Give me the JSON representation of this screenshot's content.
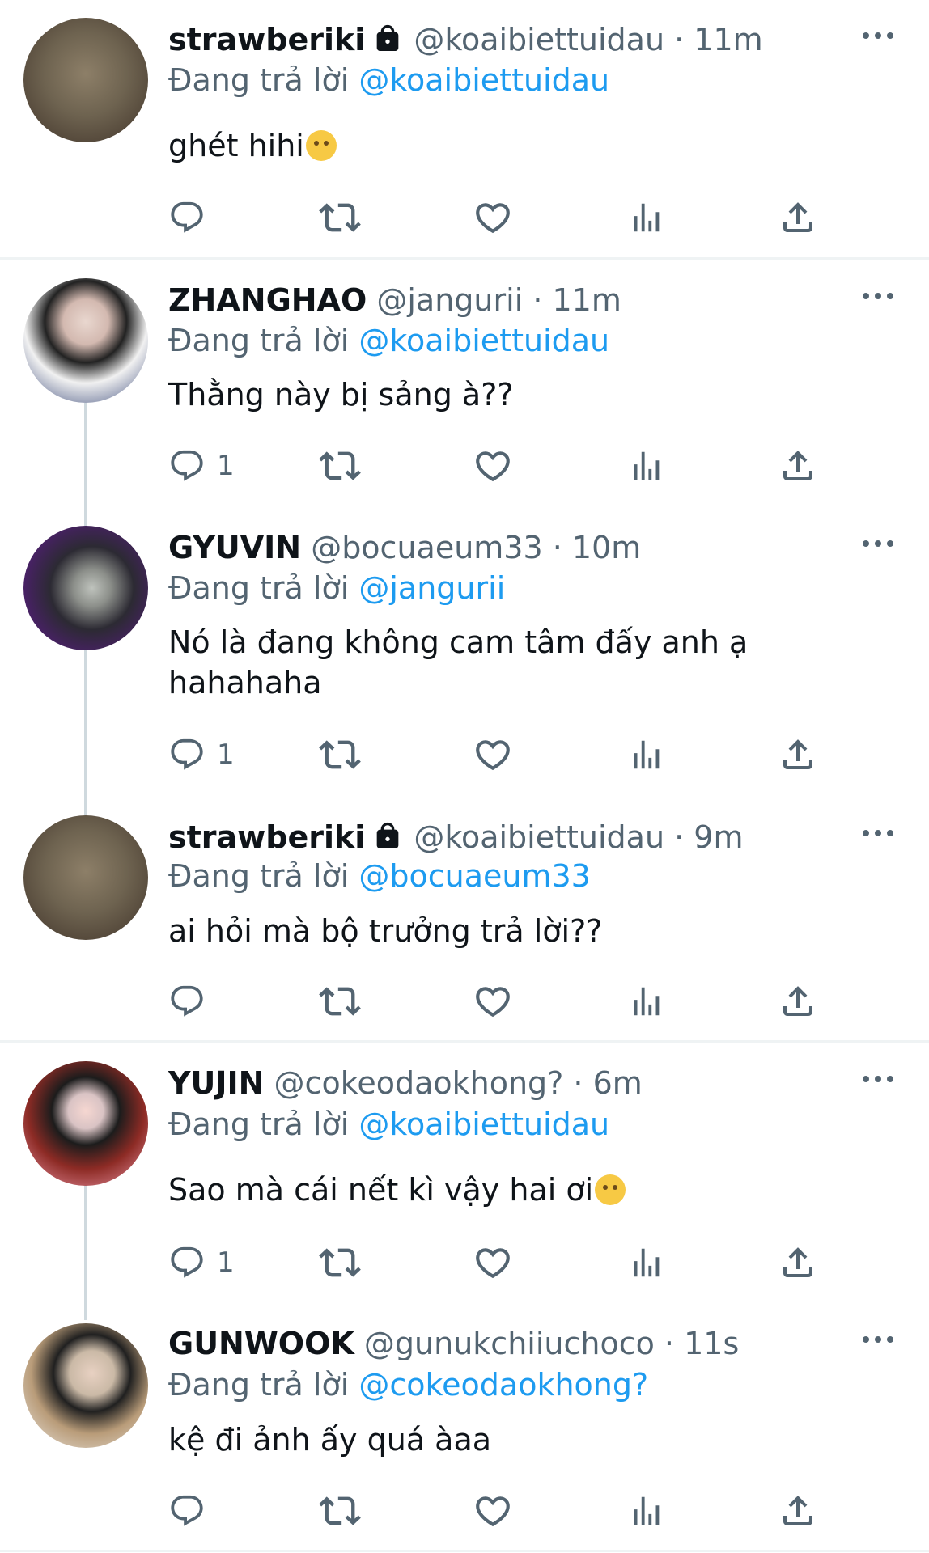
{
  "reply_prefix": "Đang trả lời",
  "tweets": [
    {
      "name": "strawberiki",
      "handle": "@koaibiettuidau",
      "time": "11m",
      "locked": true,
      "replying_to": "@koaibiettuidau",
      "text": "ghét hihi",
      "emoji": "smiling-face",
      "reply_count": ""
    },
    {
      "name": "ZHANGHAO",
      "handle": "@jangurii",
      "time": "11m",
      "locked": false,
      "replying_to": "@koaibiettuidau",
      "text": "Thằng này bị sảng à??",
      "reply_count": "1"
    },
    {
      "name": "GYUVIN",
      "handle": "@bocuaeum33",
      "time": "10m",
      "locked": false,
      "replying_to": "@jangurii",
      "text": "Nó là đang không cam tâm đấy anh ạ\nhahahaha",
      "reply_count": "1"
    },
    {
      "name": "strawberiki",
      "handle": "@koaibiettuidau",
      "time": "9m",
      "locked": true,
      "replying_to": "@bocuaeum33",
      "text": "ai hỏi mà bộ trưởng trả lời??",
      "reply_count": ""
    },
    {
      "name": "YUJIN",
      "handle": "@cokeodaokhong?",
      "time": "6m",
      "locked": false,
      "replying_to": "@koaibiettuidau",
      "text": "Sao mà cái nết kì vậy hai ơi",
      "emoji": "confused-face",
      "reply_count": "1"
    },
    {
      "name": "GUNWOOK",
      "handle": "@gunukchiiuchoco",
      "time": "11s",
      "locked": false,
      "replying_to": "@cokeodaokhong?",
      "text": "kệ đi ảnh ấy quá àaa",
      "reply_count": ""
    }
  ],
  "colors": {
    "link": "#1d9bf0",
    "muted": "#536471",
    "text": "#0f1419",
    "divider": "#eff3f4"
  },
  "icons": [
    "reply-icon",
    "retweet-icon",
    "like-icon",
    "views-icon",
    "share-icon",
    "more-icon",
    "lock-icon"
  ]
}
